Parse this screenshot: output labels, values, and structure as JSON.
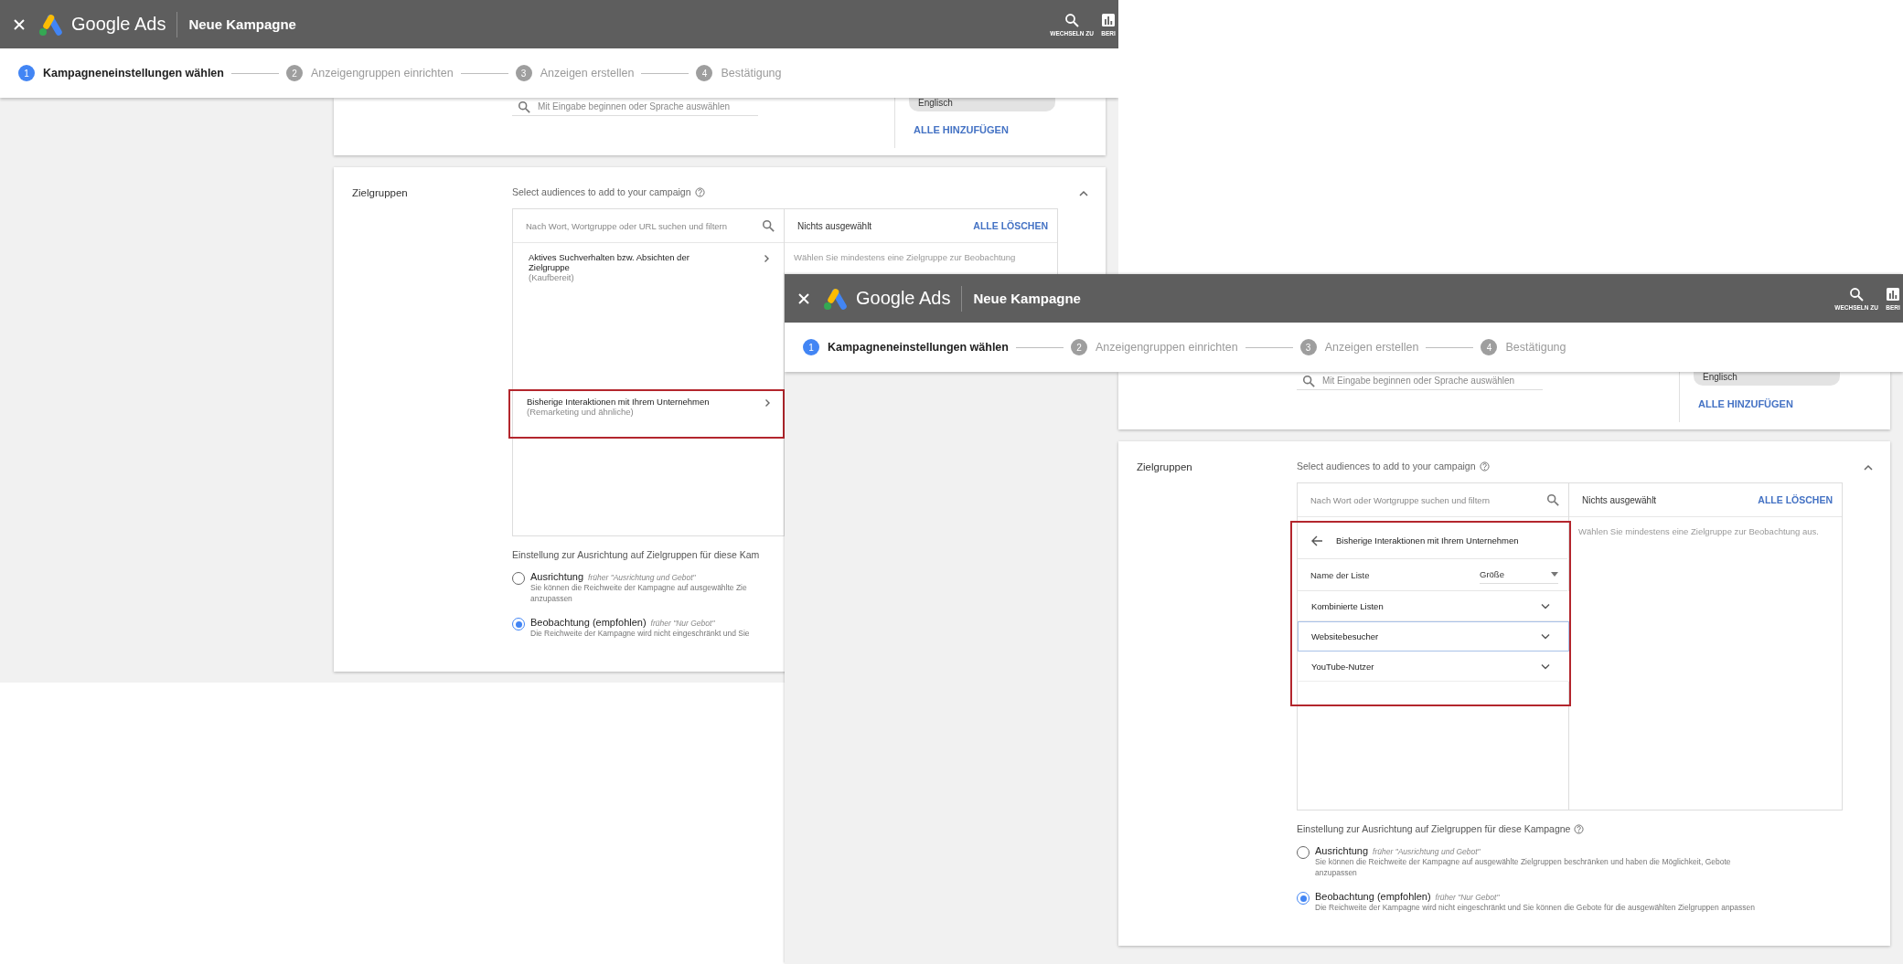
{
  "screenshots": [
    {
      "header": {
        "brand": "Google Ads",
        "title": "Neue Kampagne",
        "actions": [
          {
            "kind": "search",
            "label": "WECHSELN ZU"
          },
          {
            "kind": "reports",
            "label": "BERI"
          }
        ]
      },
      "steps": [
        {
          "number": "1",
          "label": "Kampagneneinstellungen wählen",
          "selected": true
        },
        {
          "number": "2",
          "label": "Anzeigengruppen einrichten",
          "selected": false
        },
        {
          "number": "3",
          "label": "Anzeigen erstellen",
          "selected": false
        },
        {
          "number": "4",
          "label": "Bestätigung",
          "selected": false
        }
      ],
      "languages": {
        "placeholder": "Mit Eingabe beginnen oder Sprache auswählen",
        "chip": "Englisch",
        "add_all": "ALLE HINZUFÜGEN"
      },
      "audiences": {
        "label": "Zielgruppen",
        "prompt": "Select audiences to add to your campaign",
        "search_placeholder": "Nach Wort, Wortgruppe oder URL suchen und filtern",
        "selection_title": "Nichts ausgewählt",
        "clear": "ALLE LÖSCHEN",
        "hint": "Wählen Sie mindestens eine Zielgruppe zur Beobachtung",
        "browser": {
          "kind": "categories",
          "items": [
            {
              "title": "Aktives Suchverhalten bzw. Absichten der Zielgruppe",
              "subtitle": "(Kaufbereit)",
              "highlighted": false
            },
            {
              "title": "Bisherige Interaktionen mit Ihrem Unternehmen",
              "subtitle": "(Remarketing und ähnliche)",
              "highlighted": true
            }
          ]
        }
      },
      "targeting": {
        "heading": "Einstellung zur Ausrichtung auf Zielgruppen für diese Kam",
        "options": [
          {
            "label": "Ausrichtung",
            "note": "früher \"Ausrichtung und Gebot\"",
            "description": [
              "Sie können die Reichweite der Kampagne auf ausgewählte Zie",
              "anzupassen"
            ],
            "selected": false
          },
          {
            "label": "Beobachtung (empfohlen)",
            "note": "früher \"Nur Gebot\"",
            "description": [
              "Die Reichweite der Kampagne wird nicht eingeschränkt und Sie"
            ],
            "selected": true
          }
        ]
      }
    },
    {
      "header": {
        "brand": "Google Ads",
        "title": "Neue Kampagne",
        "actions": [
          {
            "kind": "search",
            "label": "WECHSELN ZU"
          },
          {
            "kind": "reports",
            "label": "BERI"
          }
        ]
      },
      "steps": [
        {
          "number": "1",
          "label": "Kampagneneinstellungen wählen",
          "selected": true
        },
        {
          "number": "2",
          "label": "Anzeigengruppen einrichten",
          "selected": false
        },
        {
          "number": "3",
          "label": "Anzeigen erstellen",
          "selected": false
        },
        {
          "number": "4",
          "label": "Bestätigung",
          "selected": false
        }
      ],
      "languages": {
        "placeholder": "Mit Eingabe beginnen oder Sprache auswählen",
        "chip": "Englisch",
        "add_all": "ALLE HINZUFÜGEN"
      },
      "audiences": {
        "label": "Zielgruppen",
        "prompt": "Select audiences to add to your campaign",
        "search_placeholder": "Nach Wort oder Wortgruppe suchen und filtern",
        "selection_title": "Nichts ausgewählt",
        "clear": "ALLE LÖSCHEN",
        "hint": "Wählen Sie mindestens eine Zielgruppe zur Beobachtung aus.",
        "browser": {
          "kind": "lists",
          "highlighted": true,
          "title": "Bisherige Interaktionen mit Ihrem Unternehmen",
          "name_column": "Name der Liste",
          "size_column": "Größe",
          "rows": [
            {
              "label": "Kombinierte Listen",
              "selected": false
            },
            {
              "label": "Websitebesucher",
              "selected": true
            },
            {
              "label": "YouTube-Nutzer",
              "selected": false
            }
          ]
        }
      },
      "targeting": {
        "heading": "Einstellung zur Ausrichtung auf Zielgruppen für diese Kampagne",
        "help": true,
        "options": [
          {
            "label": "Ausrichtung",
            "note": "früher \"Ausrichtung und Gebot\"",
            "description": [
              "Sie können die Reichweite der Kampagne auf ausgewählte Zielgruppen beschränken und haben die Möglichkeit, Gebote",
              "anzupassen"
            ],
            "selected": false
          },
          {
            "label": "Beobachtung (empfohlen)",
            "note": "früher \"Nur Gebot\"",
            "description": [
              "Die Reichweite der Kampagne wird nicht eingeschränkt und Sie können die Gebote für die ausgewählten Zielgruppen anpassen"
            ],
            "selected": true
          }
        ]
      }
    }
  ]
}
